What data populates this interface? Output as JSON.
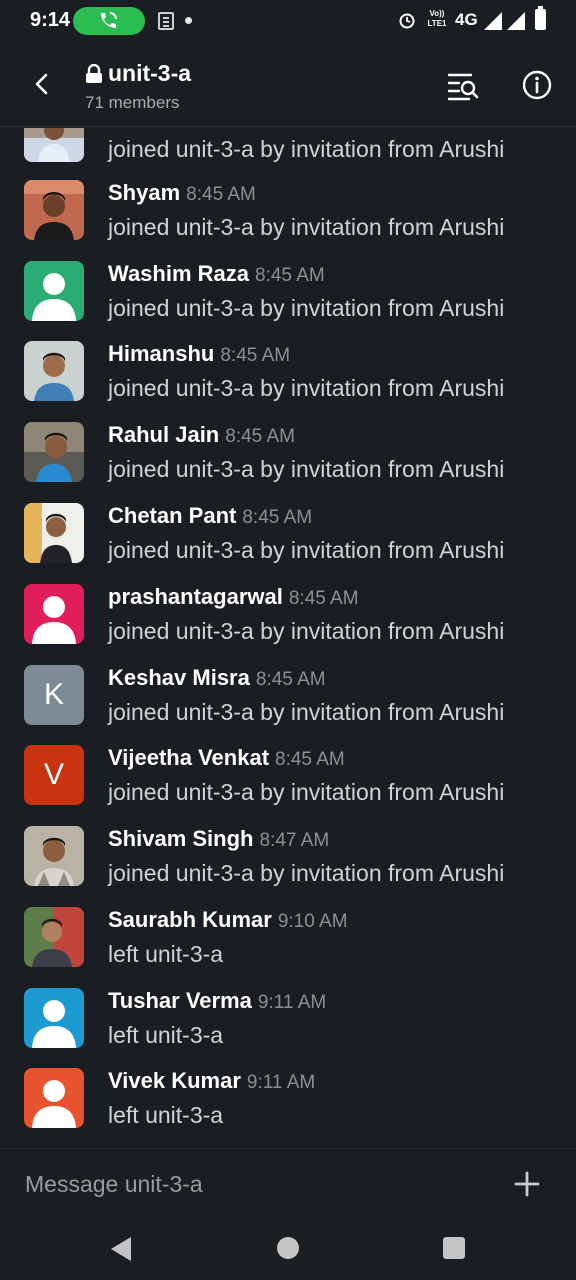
{
  "status_bar": {
    "time": "9:14",
    "volte_label": "Vo)) LTE1",
    "network": "4G"
  },
  "header": {
    "channel_name": "unit-3-a",
    "member_count": "71 members"
  },
  "messages": [
    {
      "name": "",
      "time": "",
      "text": "joined unit-3-a by invitation from Arushi",
      "avatar": "photo"
    },
    {
      "name": "Shyam",
      "time": "8:45 AM",
      "text": "joined unit-3-a by invitation from Arushi",
      "avatar": "photo"
    },
    {
      "name": "Washim Raza",
      "time": "8:45 AM",
      "text": "joined unit-3-a by invitation from Arushi",
      "avatar": "default-user",
      "avatar_color": "#2bac76"
    },
    {
      "name": "Himanshu",
      "time": "8:45 AM",
      "text": "joined unit-3-a by invitation from Arushi",
      "avatar": "photo"
    },
    {
      "name": "Rahul Jain",
      "time": "8:45 AM",
      "text": "joined unit-3-a by invitation from Arushi",
      "avatar": "photo"
    },
    {
      "name": "Chetan Pant",
      "time": "8:45 AM",
      "text": "joined unit-3-a by invitation from Arushi",
      "avatar": "photo"
    },
    {
      "name": "prashantagarwal",
      "time": "8:45 AM",
      "text": "joined unit-3-a by invitation from Arushi",
      "avatar": "default-user",
      "avatar_color": "#e01e5a"
    },
    {
      "name": "Keshav Misra",
      "time": "8:45 AM",
      "text": "joined unit-3-a by invitation from Arushi",
      "avatar": "letter",
      "letter": "K",
      "avatar_color": "#7f8b94"
    },
    {
      "name": "Vijeetha Venkat",
      "time": "8:45 AM",
      "text": "joined unit-3-a by invitation from Arushi",
      "avatar": "letter",
      "letter": "V",
      "avatar_color": "#c7340f"
    },
    {
      "name": "Shivam Singh",
      "time": "8:47 AM",
      "text": "joined unit-3-a by invitation from Arushi",
      "avatar": "photo"
    },
    {
      "name": "Saurabh Kumar",
      "time": "9:10 AM",
      "text": "left unit-3-a",
      "avatar": "photo"
    },
    {
      "name": "Tushar Verma",
      "time": "9:11 AM",
      "text": "left unit-3-a",
      "avatar": "default-user",
      "avatar_color": "#1d9bd1"
    },
    {
      "name": "Vivek Kumar",
      "time": "9:11 AM",
      "text": "left unit-3-a",
      "avatar": "default-user",
      "avatar_color": "#e8542f"
    }
  ],
  "composer": {
    "placeholder": "Message unit-3-a"
  },
  "colors": {
    "background": "#1a1d21",
    "call_pill": "#2bbd52",
    "name_text": "#ffffff",
    "body_text": "#d1d2d3",
    "time_text": "#8e8f91"
  },
  "icons": {
    "back": "arrow-left-icon",
    "lock": "lock-icon",
    "search": "search-list-icon",
    "info": "info-icon",
    "plus": "plus-icon"
  }
}
